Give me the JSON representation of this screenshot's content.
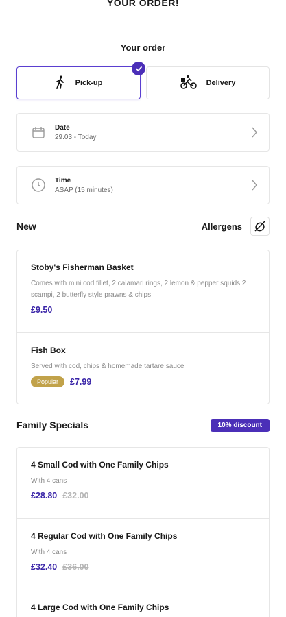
{
  "header": {
    "title": "YOUR ORDER!"
  },
  "order": {
    "section_title": "Your order",
    "pickup_label": "Pick-up",
    "delivery_label": "Delivery",
    "date_label": "Date",
    "date_value": "29.03 - Today",
    "time_label": "Time",
    "time_value": "ASAP (15 minutes)"
  },
  "new_section": {
    "title": "New",
    "allergens_label": "Allergens",
    "items": [
      {
        "name": "Stoby's Fisherman Basket",
        "description": "Comes with mini cod fillet, 2 calamari rings, 2 lemon & pepper squids,2 scampi, 2 butterfly style prawns & chips",
        "price": "£9.50"
      },
      {
        "name": "Fish Box",
        "description": "Served with cod, chips & homemade tartare sauce",
        "badge": "Popular",
        "price": "£7.99"
      }
    ]
  },
  "family_section": {
    "title": "Family Specials",
    "discount_label": "10% discount",
    "items": [
      {
        "name": "4 Small Cod with One Family Chips",
        "description": "With 4 cans",
        "price": "£28.80",
        "old_price": "£32.00"
      },
      {
        "name": "4 Regular Cod with One Family Chips",
        "description": "With 4 cans",
        "price": "£32.40",
        "old_price": "£36.00"
      },
      {
        "name": "4 Large Cod with One Family Chips"
      }
    ]
  },
  "colors": {
    "accent": "#4b2fb8",
    "price": "#3a25a8",
    "popular": "#c1a24a"
  }
}
